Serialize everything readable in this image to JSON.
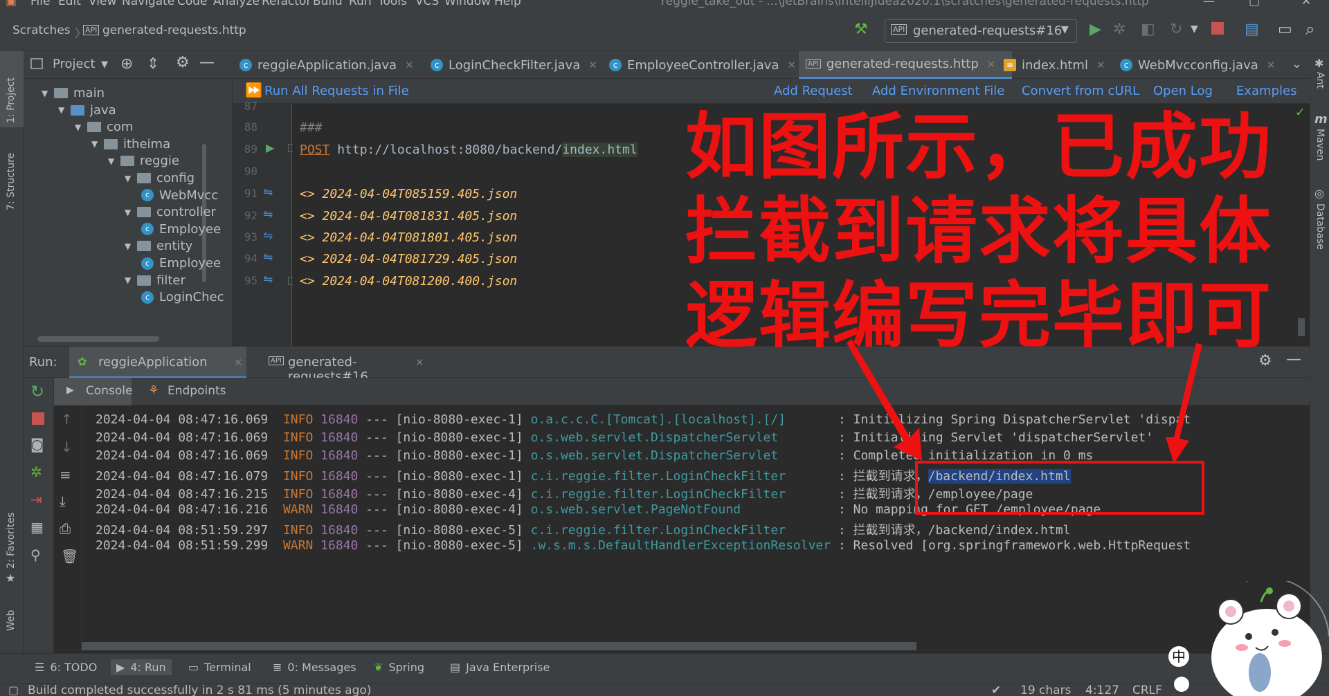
{
  "menu": [
    "File",
    "Edit",
    "View",
    "Navigate",
    "Code",
    "Analyze",
    "Refactor",
    "Build",
    "Run",
    "Tools",
    "VCS",
    "Window",
    "Help"
  ],
  "window_title": "reggie_take_out - ...\\JetBrains\\IntelliJIdea2020.1\\scratches\\generated-requests.http",
  "breadcrumb": {
    "root": "Scratches",
    "file": "generated-requests.http"
  },
  "run_config": "generated-requests#16",
  "editor_tabs": [
    {
      "label": "reggieApplication.java",
      "icon": "spring-class-icon"
    },
    {
      "label": "LoginCheckFilter.java",
      "icon": "class-icon"
    },
    {
      "label": "EmployeeController.java",
      "icon": "class-icon"
    },
    {
      "label": "generated-requests.http",
      "icon": "api-icon",
      "active": true
    },
    {
      "label": "index.html",
      "icon": "html-icon"
    },
    {
      "label": "WebMvcconfig.java",
      "icon": "class-icon"
    }
  ],
  "project_panel": {
    "title": "Project",
    "tree": [
      {
        "label": "main",
        "depth": 0,
        "kind": "folder"
      },
      {
        "label": "java",
        "depth": 1,
        "kind": "folder-blue"
      },
      {
        "label": "com",
        "depth": 2,
        "kind": "folder"
      },
      {
        "label": "itheima",
        "depth": 3,
        "kind": "folder"
      },
      {
        "label": "reggie",
        "depth": 4,
        "kind": "folder"
      },
      {
        "label": "config",
        "depth": 5,
        "kind": "folder"
      },
      {
        "label": "WebMvcc",
        "depth": 6,
        "kind": "class"
      },
      {
        "label": "controller",
        "depth": 5,
        "kind": "folder"
      },
      {
        "label": "Employee",
        "depth": 6,
        "kind": "class"
      },
      {
        "label": "entity",
        "depth": 5,
        "kind": "folder"
      },
      {
        "label": "Employee",
        "depth": 6,
        "kind": "class"
      },
      {
        "label": "filter",
        "depth": 5,
        "kind": "folder"
      },
      {
        "label": "LoginChec",
        "depth": 6,
        "kind": "class"
      }
    ]
  },
  "left_strip": [
    "1: Project",
    "7: Structure",
    "2: Favorites",
    "Web"
  ],
  "right_strip": [
    "Ant",
    "Maven",
    "Database"
  ],
  "request_toolbar": {
    "run_all": "Run All Requests in File",
    "actions": [
      "Add Request",
      "Add Environment File",
      "Convert from cURL",
      "Open Log",
      "Examples"
    ]
  },
  "code_lines": [
    {
      "num": "87",
      "text": ""
    },
    {
      "num": "88",
      "text": "###"
    },
    {
      "num": "89",
      "method": "POST",
      "url_prefix": " http://localhost:8080/backend/",
      "url_file": "index.html"
    },
    {
      "num": "90",
      "text": ""
    },
    {
      "num": "91",
      "text": "<> 2024-04-04T085159.405.json"
    },
    {
      "num": "92",
      "text": "<> 2024-04-04T081831.405.json"
    },
    {
      "num": "93",
      "text": "<> 2024-04-04T081801.405.json"
    },
    {
      "num": "94",
      "text": "<> 2024-04-04T081729.405.json"
    },
    {
      "num": "95",
      "text": "<> 2024-04-04T081200.400.json"
    }
  ],
  "overlay": {
    "line1": "如图所示，已成功",
    "line2": "拦截到请求将具体",
    "line3": "逻辑编写完毕即可",
    "color": "#ee1111"
  },
  "run_panel": {
    "label": "Run:",
    "tabs": [
      "reggieApplication",
      "generated-requests#16"
    ],
    "console_tabs": [
      "Console",
      "Endpoints"
    ]
  },
  "log": [
    {
      "ts": "2024-04-04 08:47:16.069",
      "level": "INFO",
      "pid": "16840",
      "sep": "---",
      "thread": "[nio-8080-exec-1]",
      "logger": "o.a.c.c.C.[Tomcat].[localhost].[/]      ",
      "msg": ": Initializing Spring DispatcherServlet 'dispat"
    },
    {
      "ts": "2024-04-04 08:47:16.069",
      "level": "INFO",
      "pid": "16840",
      "sep": "---",
      "thread": "[nio-8080-exec-1]",
      "logger": "o.s.web.servlet.DispatcherServlet       ",
      "msg": ": Initializing Servlet 'dispatcherServlet'"
    },
    {
      "ts": "2024-04-04 08:47:16.069",
      "level": "INFO",
      "pid": "16840",
      "sep": "---",
      "thread": "[nio-8080-exec-1]",
      "logger": "o.s.web.servlet.DispatcherServlet       ",
      "msg": ": Completed initialization in 0 ms"
    },
    {
      "ts": "2024-04-04 08:47:16.079",
      "level": "INFO",
      "pid": "16840",
      "sep": "---",
      "thread": "[nio-8080-exec-1]",
      "logger": "c.i.reggie.filter.LoginCheckFilter      ",
      "msg": ": 拦截到请求，",
      "msg_sel": "/backend/index.html"
    },
    {
      "ts": "2024-04-04 08:47:16.215",
      "level": "INFO",
      "pid": "16840",
      "sep": "---",
      "thread": "[nio-8080-exec-4]",
      "logger": "c.i.reggie.filter.LoginCheckFilter      ",
      "msg": ": 拦截到请求，/employee/page"
    },
    {
      "ts": "2024-04-04 08:47:16.216",
      "level": "WARN",
      "pid": "16840",
      "sep": "---",
      "thread": "[nio-8080-exec-4]",
      "logger": "o.s.web.servlet.PageNotFound            ",
      "msg": ": No mapping for GET /employee/page"
    },
    {
      "ts": "2024-04-04 08:51:59.297",
      "level": "INFO",
      "pid": "16840",
      "sep": "---",
      "thread": "[nio-8080-exec-5]",
      "logger": "c.i.reggie.filter.LoginCheckFilter      ",
      "msg": ": 拦截到请求，/backend/index.html"
    },
    {
      "ts": "2024-04-04 08:51:59.299",
      "level": "WARN",
      "pid": "16840",
      "sep": "---",
      "thread": "[nio-8080-exec-5]",
      "logger": ".w.s.m.s.DefaultHandlerExceptionResolver",
      "msg": ": Resolved [org.springframework.web.HttpRequest"
    }
  ],
  "bottom_tools": [
    "6: TODO",
    "4: Run",
    "Terminal",
    "0: Messages",
    "Spring",
    "Java Enterprise"
  ],
  "status": {
    "message": "Build completed successfully in 2 s 81 ms (5 minutes ago)",
    "chars": "19 chars",
    "position": "4:127",
    "line_sep": "CRLF",
    "ime": "中"
  },
  "colors": {
    "panel": "#3c3f41",
    "editor": "#2b2b2b",
    "link": "#589df6",
    "logger": "#3d9aa1",
    "level": "#cc7832",
    "pid": "#9876aa",
    "italic_json": "#ffc66d"
  }
}
